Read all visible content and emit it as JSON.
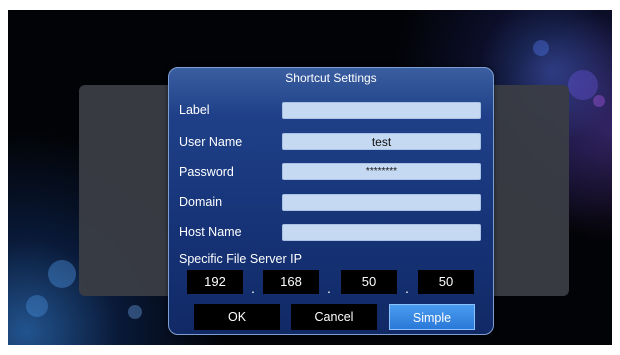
{
  "dialog": {
    "title": "Shortcut Settings",
    "fields": [
      {
        "label": "Label",
        "value": ""
      },
      {
        "label": "User Name",
        "value": "test"
      },
      {
        "label": "Password",
        "value": "********"
      },
      {
        "label": "Domain",
        "value": ""
      },
      {
        "label": "Host Name",
        "value": ""
      }
    ],
    "ip_label": "Specific File Server IP",
    "ip": [
      "192",
      "168",
      "50",
      "50"
    ],
    "ip_separator": ".",
    "buttons": {
      "ok": "OK",
      "cancel": "Cancel",
      "simple": "Simple"
    },
    "selected_button": "simple",
    "accent_color": "#2a78d8",
    "field_color": "#c6d9f3"
  }
}
